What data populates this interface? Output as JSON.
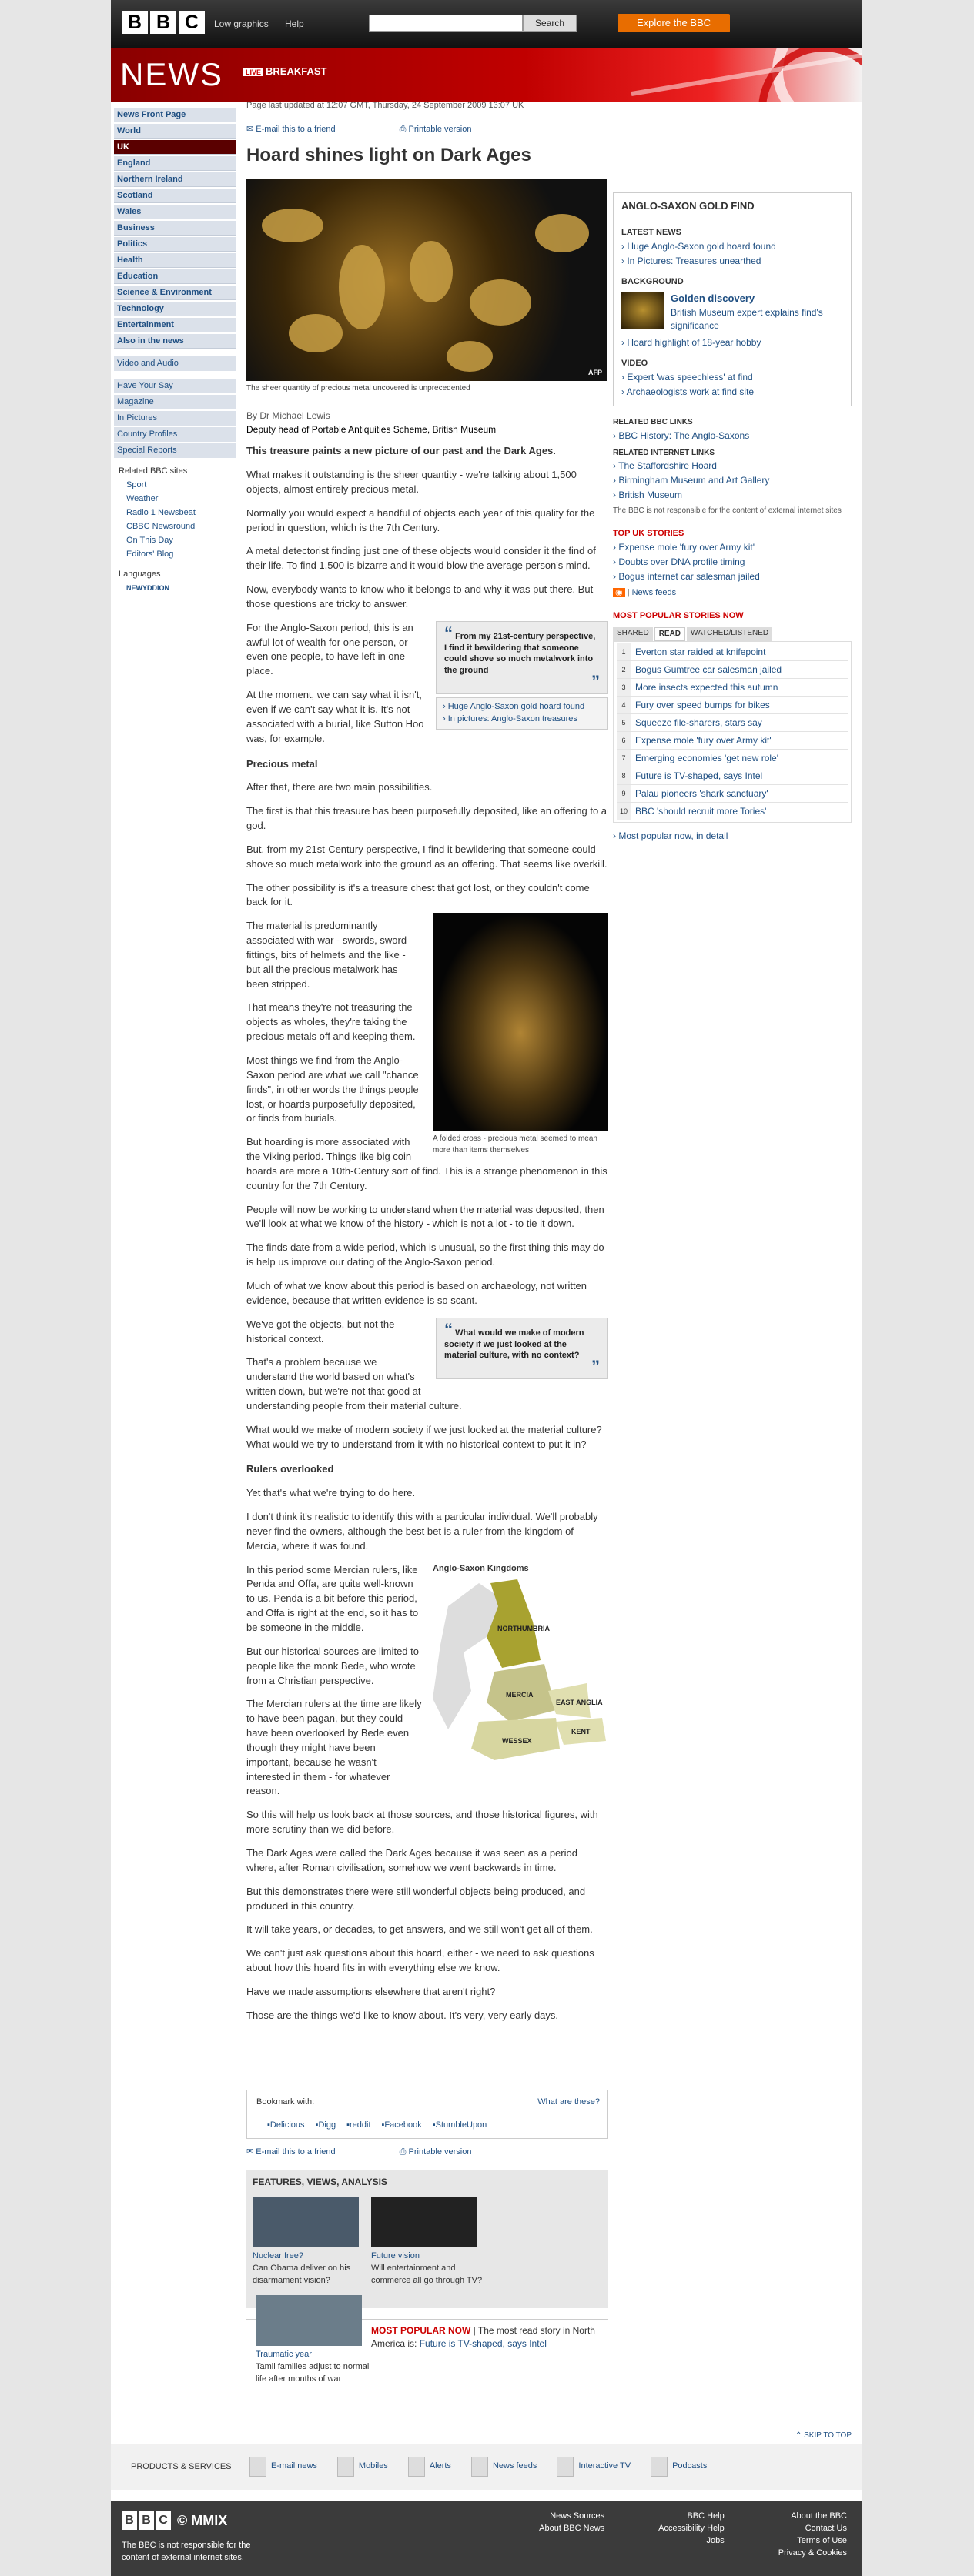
{
  "topbar": {
    "logo": [
      "B",
      "B",
      "C"
    ],
    "low_graphics": "Low graphics",
    "help": "Help",
    "search": "Search",
    "explore": "Explore the BBC"
  },
  "banner": {
    "title": "NEWS",
    "live": "LIVE",
    "program": "BREAKFAST"
  },
  "nav": {
    "items": [
      "News Front Page",
      "World",
      "UK",
      "England",
      "Northern Ireland",
      "Scotland",
      "Wales",
      "Business",
      "Politics",
      "Health",
      "Education",
      "Science & Environment",
      "Technology",
      "Entertainment",
      "Also in the news"
    ],
    "media": [
      "Video and Audio"
    ],
    "more": [
      "Have Your Say",
      "Magazine",
      "In Pictures",
      "Country Profiles",
      "Special Reports"
    ],
    "related_title": "Related BBC sites",
    "related": [
      "Sport",
      "Weather",
      "Radio 1 Newsbeat",
      "CBBC Newsround",
      "On This Day",
      "Editors' Blog"
    ],
    "languages": "Languages",
    "lang_item": "NEWYDDION"
  },
  "article": {
    "updated": "Page last updated at 12:07 GMT, Thursday, 24 September 2009 13:07 UK",
    "email": "E-mail this to a friend",
    "print": "Printable version",
    "headline": "Hoard shines light on Dark Ages",
    "photo_caption": "The sheer quantity of precious metal uncovered is unprecedented",
    "photo_credit": "AFP",
    "byline": "By Dr Michael Lewis",
    "role": "Deputy head of Portable Antiquities Scheme, British Museum",
    "intro": "This treasure paints a new picture of our past and the Dark Ages.",
    "p1": "What makes it outstanding is the sheer quantity - we're talking about 1,500 objects, almost entirely precious metal.",
    "p2": "Normally you would expect a handful of objects each year of this quality for the period in question, which is the 7th Century.",
    "p3": "A metal detectorist finding just one of these objects would consider it the find of their life. To find 1,500 is bizarre and it would blow the average person's mind.",
    "p4": "Now, everybody wants to know who it belongs to and why it was put there. But those questions are tricky to answer.",
    "quote1": "From my 21st-century perspective, I find it bewildering that someone could shove so much metalwork into the ground",
    "qlinks": [
      "Huge Anglo-Saxon gold hoard found",
      "In pictures: Anglo-Saxon treasures"
    ],
    "p5": "For the Anglo-Saxon period, this is an awful lot of wealth for one person, or even one people, to have left in one place.",
    "p6": "At the moment, we can say what it isn't, even if we can't say what it is. It's not associated with a burial, like Sutton Hoo was, for example.",
    "sub1": "Precious metal",
    "p7": "After that, there are two main possibilities.",
    "p8": "The first is that this treasure has been purposefully deposited, like an offering to a god.",
    "p9": "But, from my 21st-Century perspective, I find it bewildering that someone could shove so much metalwork into the ground as an offering. That seems like overkill.",
    "p10": "The other possibility is it's a treasure chest that got lost, or they couldn't come back for it.",
    "cross_caption": "A folded cross - precious metal seemed to mean more than items themselves",
    "p11": "The material is predominantly associated with war - swords, sword fittings, bits of helmets and the like - but all the precious metalwork has been stripped.",
    "p12": "That means they're not treasuring the objects as wholes, they're taking the precious metals off and keeping them.",
    "p13": "Most things we find from the Anglo-Saxon period are what we call \"chance finds\", in other words the things people lost, or hoards purposefully deposited, or finds from burials.",
    "p14": "But hoarding is more associated with the Viking period. Things like big coin hoards are more a 10th-Century sort of find. This is a strange phenomenon in this country for the 7th Century.",
    "p15": "People will now be working to understand when the material was deposited, then we'll look at what we know of the history - which is not a lot - to tie it down.",
    "p16": "The finds date from a wide period, which is unusual, so the first thing this may do is help us improve our dating of the Anglo-Saxon period.",
    "p17": "Much of what we know about this period is based on archaeology, not written evidence, because that written evidence is so scant.",
    "quote2": "What would we make of modern society if we just looked at the material culture, with no context?",
    "p18": "We've got the objects, but not the historical context.",
    "p19": "That's a problem because we understand the world based on what's written down, but we're not that good at understanding people from their material culture.",
    "p20": "What would we make of modern society if we just looked at the material culture? What would we try to understand from it with no historical context to put it in?",
    "sub2": "Rulers overlooked",
    "p21": "Yet that's what we're trying to do here.",
    "p22": "I don't think it's realistic to identify this with a particular individual. We'll probably never find the owners, although the best bet is a ruler from the kingdom of Mercia, where it was found.",
    "map_title": "Anglo-Saxon Kingdoms",
    "map_labels": [
      "NORTHUMBRIA",
      "MERCIA",
      "EAST ANGLIA",
      "KENT",
      "WESSEX"
    ],
    "p23": "In this period some Mercian rulers, like Penda and Offa, are quite well-known to us. Penda is a bit before this period, and Offa is right at the end, so it has to be someone in the middle.",
    "p24": "But our historical sources are limited to people like the monk Bede, who wrote from a Christian perspective.",
    "p25": "The Mercian rulers at the time are likely to have been pagan, but they could have been overlooked by Bede even though they might have been important, because he wasn't interested in them - for whatever reason.",
    "p26": "So this will help us look back at those sources, and those historical figures, with more scrutiny than we did before.",
    "p27": "The Dark Ages were called the Dark Ages because it was seen as a period where, after Roman civilisation, somehow we went backwards in time.",
    "p28": "But this demonstrates there were still wonderful objects being produced, and produced in this country.",
    "p29": "It will take years, or decades, to get answers, and we still won't get all of them.",
    "p30": "We can't just ask questions about this hoard, either - we need to ask questions about how this hoard fits in with everything else we know.",
    "p31": "Have we made assumptions elsewhere that aren't right?",
    "p32": "Those are the things we'd like to know about. It's very, very early days."
  },
  "bookmark": {
    "title": "Bookmark with:",
    "what": "What are these?",
    "services": [
      "Delicious",
      "Digg",
      "reddit",
      "Facebook",
      "StumbleUpon"
    ]
  },
  "features": {
    "title": "FEATURES, VIEWS, ANALYSIS",
    "items": [
      {
        "title": "Nuclear free?",
        "text": "Can Obama deliver on his disarmament vision?"
      },
      {
        "title": "Future vision",
        "text": "Will entertainment and commerce all go through TV?"
      },
      {
        "title": "Traumatic year",
        "text": "Tamil families adjust to normal life after months of war"
      }
    ]
  },
  "mpn": {
    "label": "MOST POPULAR NOW",
    "text": "The most read story in North America is:",
    "link": "Future is TV-shaped, says Intel"
  },
  "skip": "SKIP TO TOP",
  "right": {
    "box_title": "ANGLO-SAXON GOLD FIND",
    "latest_title": "LATEST NEWS",
    "latest": [
      "Huge Anglo-Saxon gold hoard found",
      "In Pictures: Treasures unearthed"
    ],
    "background_title": "BACKGROUND",
    "bg_link": "Golden discovery",
    "bg_text": "British Museum expert explains find's significance",
    "bg_item": "Hoard highlight of 18-year hobby",
    "video_title": "VIDEO",
    "videos": [
      "Expert 'was speechless' at find",
      "Archaeologists work at find site"
    ],
    "rel_bbc_title": "RELATED BBC LINKS",
    "rel_bbc": [
      "BBC History: The Anglo-Saxons"
    ],
    "rel_int_title": "RELATED INTERNET LINKS",
    "rel_int": [
      "The Staffordshire Hoard",
      "Birmingham Museum and Art Gallery",
      "British Museum"
    ],
    "disclaimer": "The BBC is not responsible for the content of external internet sites",
    "top_title": "TOP UK STORIES",
    "top": [
      "Expense mole 'fury over Army kit'",
      "Doubts over DNA profile timing",
      "Bogus internet car salesman jailed"
    ],
    "feeds": "News feeds",
    "mp_title": "MOST POPULAR STORIES NOW",
    "tabs": [
      "SHARED",
      "READ",
      "WATCHED/LISTENED"
    ],
    "mp": [
      "Everton star raided at knifepoint",
      "Bogus Gumtree car salesman jailed",
      "More insects expected this autumn",
      "Fury over speed bumps for bikes",
      "Squeeze file-sharers, stars say",
      "Expense mole 'fury over Army kit'",
      "Emerging economies 'get new role'",
      "Future is TV-shaped, says Intel",
      "Palau pioneers 'shark sanctuary'",
      "BBC 'should recruit more Tories'"
    ],
    "mp_more": "Most popular now, in detail"
  },
  "footer": {
    "label": "PRODUCTS & SERVICES",
    "items": [
      "E-mail news",
      "Mobiles",
      "Alerts",
      "News feeds",
      "Interactive TV",
      "Podcasts"
    ],
    "copyright": "© MMIX",
    "disclaimer": "The BBC is not responsible for the content of external internet sites.",
    "col1": [
      "News Sources",
      "About BBC News"
    ],
    "col2": [
      "BBC Help",
      "Accessibility Help",
      "Jobs"
    ],
    "col3": [
      "About the BBC",
      "Contact Us",
      "Terms of Use",
      "Privacy & Cookies"
    ]
  }
}
